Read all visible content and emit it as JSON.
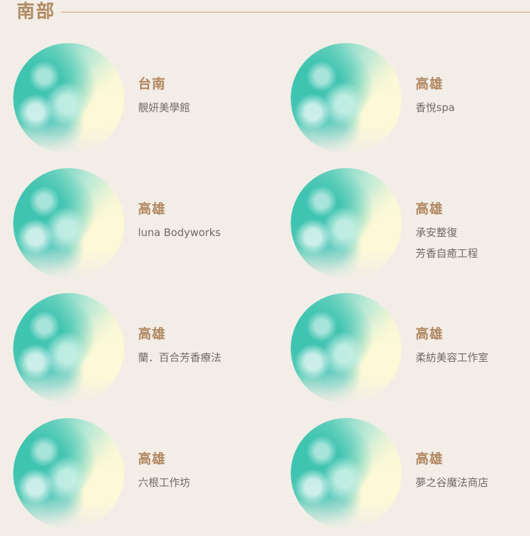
{
  "section": {
    "title": "南部",
    "rule_color": "#d9a17e",
    "title_color": "#b08a62"
  },
  "shops": [
    {
      "city": "台南",
      "name_lines": [
        "靚妍美學館"
      ]
    },
    {
      "city": "高雄",
      "name_lines": [
        "香悅spa"
      ]
    },
    {
      "city": "高雄",
      "name_lines": [
        "luna Bodyworks"
      ]
    },
    {
      "city": "高雄",
      "name_lines": [
        "承安整復",
        "芳香自癒工程"
      ]
    },
    {
      "city": "高雄",
      "name_lines": [
        "蘭．百合芳香療法"
      ]
    },
    {
      "city": "高雄",
      "name_lines": [
        "柔紡美容工作室"
      ]
    },
    {
      "city": "高雄",
      "name_lines": [
        "六根工作坊"
      ]
    },
    {
      "city": "高雄",
      "name_lines": [
        "夢之谷魔法商店"
      ]
    }
  ],
  "colors": {
    "background": "#f5f0ea",
    "city_text": "#b08660",
    "name_text": "#6e6a66",
    "avatar_teal": "#52c8b6",
    "avatar_cream": "#fdfadc"
  }
}
